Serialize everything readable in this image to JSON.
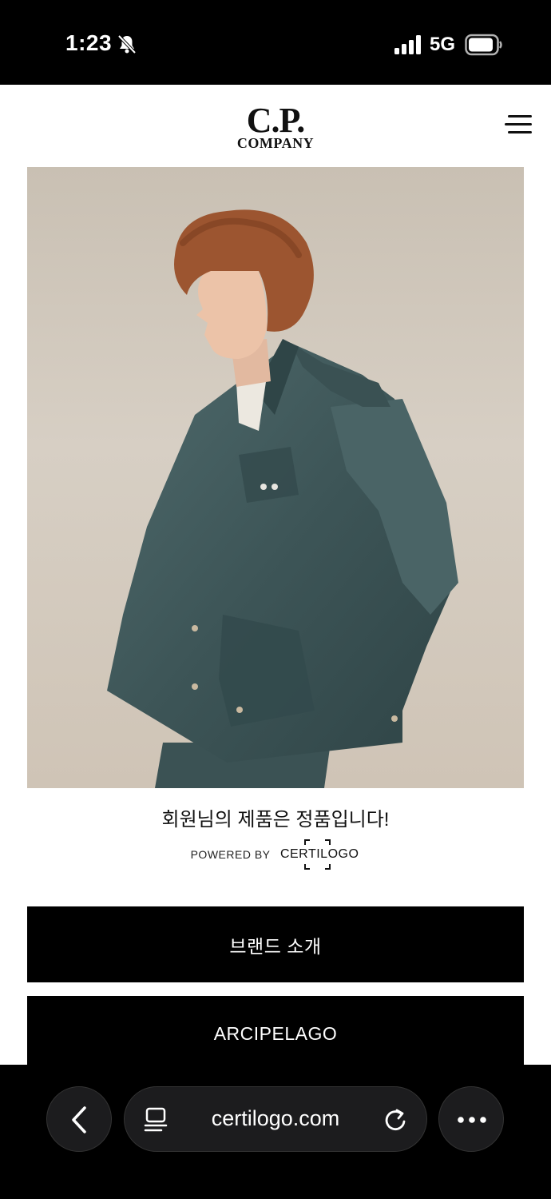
{
  "status_bar": {
    "time": "1:23",
    "network": "5G",
    "icons": [
      "bell-slash-icon",
      "cellular-signal-icon",
      "battery-icon"
    ]
  },
  "header": {
    "logo_line1": "C.P.",
    "logo_line2": "COMPANY",
    "menu_icon": "hamburger-menu-icon"
  },
  "hero": {
    "description_icon": "product-photo"
  },
  "verification": {
    "message": "회원님의 제품은 정품입니다!",
    "powered_by": "POWERED BY",
    "brand": "CERTILOGO"
  },
  "buttons": {
    "brand_intro": "브랜드 소개",
    "arcipelago": "ARCIPELAGO"
  },
  "browser": {
    "url": "certilogo.com",
    "icons": [
      "back-chevron-icon",
      "reader-icon",
      "reload-icon",
      "more-icon"
    ]
  },
  "colors": {
    "background": "#ffffff",
    "button": "#000000",
    "button_text": "#ffffff",
    "chrome": "#000000"
  }
}
